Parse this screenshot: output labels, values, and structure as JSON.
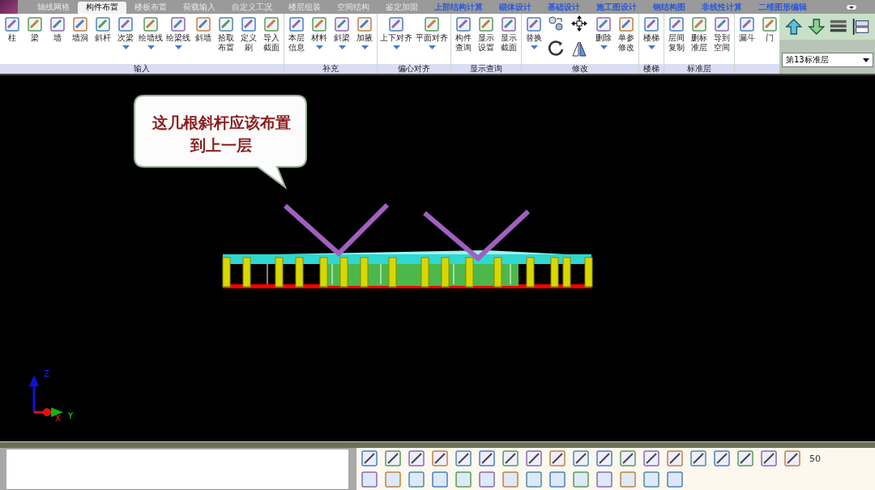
{
  "tabs": [
    {
      "label": "轴线网格",
      "kind": "module",
      "selected": false
    },
    {
      "label": "构件布置",
      "kind": "module",
      "selected": true
    },
    {
      "label": "楼板布置",
      "kind": "module",
      "selected": false
    },
    {
      "label": "荷载输入",
      "kind": "module",
      "selected": false
    },
    {
      "label": "自定义工况",
      "kind": "module",
      "selected": false
    },
    {
      "label": "楼层组装",
      "kind": "module",
      "selected": false
    },
    {
      "label": "空间结构",
      "kind": "module",
      "selected": false
    },
    {
      "label": "鉴定加固",
      "kind": "module",
      "selected": false
    },
    {
      "label": "上部结构计算",
      "kind": "program",
      "selected": false
    },
    {
      "label": "砌体设计",
      "kind": "program",
      "selected": false
    },
    {
      "label": "基础设计",
      "kind": "program",
      "selected": false
    },
    {
      "label": "施工图设计",
      "kind": "program",
      "selected": false
    },
    {
      "label": "钢结构图",
      "kind": "program",
      "selected": false
    },
    {
      "label": "非线性计算",
      "kind": "program",
      "selected": false
    },
    {
      "label": "二维图形编辑",
      "kind": "program",
      "selected": false
    }
  ],
  "ribbon_groups": [
    {
      "label": "输入",
      "tools": [
        {
          "kind": "large",
          "lines": [
            "柱"
          ],
          "dropdown": false
        },
        {
          "kind": "large",
          "lines": [
            "梁"
          ],
          "dropdown": false
        },
        {
          "kind": "large",
          "lines": [
            "墙"
          ],
          "dropdown": false
        },
        {
          "kind": "large",
          "lines": [
            "墙洞"
          ],
          "dropdown": false
        },
        {
          "kind": "large",
          "lines": [
            "斜杆"
          ],
          "dropdown": false
        },
        {
          "kind": "large",
          "lines": [
            "次梁"
          ],
          "dropdown": true
        },
        {
          "kind": "large",
          "lines": [
            "绘墙线"
          ],
          "dropdown": true
        },
        {
          "kind": "large",
          "lines": [
            "绘梁线"
          ],
          "dropdown": true
        },
        {
          "kind": "large",
          "lines": [
            "斜墙"
          ],
          "dropdown": false
        },
        {
          "kind": "large",
          "lines": [
            "拾取",
            "布置"
          ],
          "dropdown": false
        },
        {
          "kind": "large",
          "lines": [
            "定义",
            "刷"
          ],
          "dropdown": false
        },
        {
          "kind": "large",
          "lines": [
            "导入",
            "截面"
          ],
          "dropdown": false
        }
      ]
    },
    {
      "label": "补充",
      "tools": [
        {
          "kind": "large",
          "lines": [
            "本层",
            "信息"
          ],
          "dropdown": false
        },
        {
          "kind": "large",
          "lines": [
            "材料"
          ],
          "dropdown": true
        },
        {
          "kind": "large",
          "lines": [
            "斜梁"
          ],
          "dropdown": true
        },
        {
          "kind": "large",
          "lines": [
            "加腋"
          ],
          "dropdown": true
        }
      ]
    },
    {
      "label": "偏心对齐",
      "tools": [
        {
          "kind": "large",
          "lines": [
            "上下对齐"
          ],
          "dropdown": true
        },
        {
          "kind": "large",
          "lines": [
            "平面对齐"
          ],
          "dropdown": true
        }
      ]
    },
    {
      "label": "显示查询",
      "tools": [
        {
          "kind": "large",
          "lines": [
            "构件",
            "查询"
          ],
          "dropdown": false
        },
        {
          "kind": "large",
          "lines": [
            "显示",
            "设置"
          ],
          "dropdown": false
        },
        {
          "kind": "large",
          "lines": [
            "显示",
            "截面"
          ],
          "dropdown": false
        }
      ]
    },
    {
      "label": "修改",
      "tools": [
        {
          "kind": "large",
          "lines": [
            "替换"
          ],
          "dropdown": true
        },
        {
          "kind": "small_grid"
        },
        {
          "kind": "large",
          "lines": [
            "删除"
          ],
          "dropdown": true
        },
        {
          "kind": "large",
          "lines": [
            "单参",
            "修改"
          ],
          "dropdown": false
        }
      ]
    },
    {
      "label": "楼梯",
      "tools": [
        {
          "kind": "large",
          "lines": [
            "楼梯"
          ],
          "dropdown": true
        }
      ]
    },
    {
      "label": "标准层",
      "tools": [
        {
          "kind": "large",
          "lines": [
            "层间",
            "复制"
          ],
          "dropdown": false
        },
        {
          "kind": "large",
          "lines": [
            "删标",
            "准层"
          ],
          "dropdown": false
        },
        {
          "kind": "large",
          "lines": [
            "导到",
            "空间"
          ],
          "dropdown": false
        }
      ]
    },
    {
      "tools": [
        {
          "kind": "large",
          "lines": [
            "漏斗"
          ],
          "dropdown": false
        },
        {
          "kind": "large",
          "lines": [
            "门"
          ],
          "dropdown": false
        }
      ]
    }
  ],
  "floor_select": {
    "value": "第13标准层"
  },
  "callout": {
    "text": "这几根斜杆应该布置到上一层"
  },
  "axes": {
    "z": "Z",
    "x": "X",
    "y": "Y"
  },
  "scale_label": "50"
}
